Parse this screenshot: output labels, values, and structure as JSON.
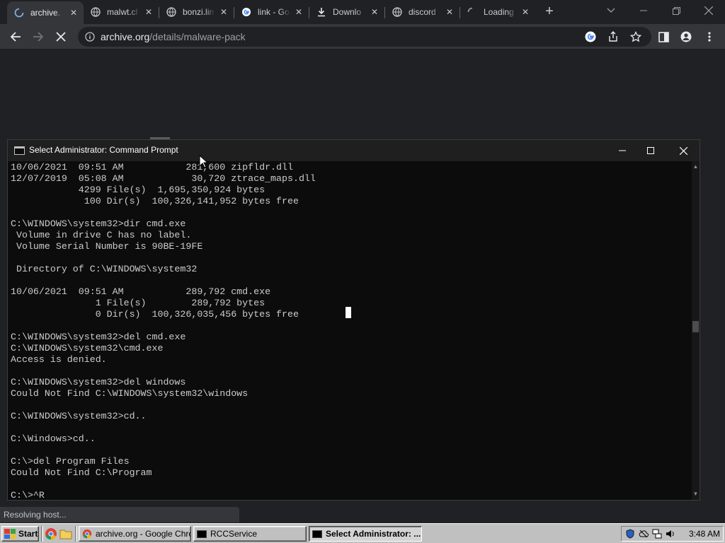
{
  "browser": {
    "tabs": [
      {
        "title": "archive.",
        "icon": "loading-spinner-icon",
        "active": true
      },
      {
        "title": "malwt.cl",
        "icon": "globe-icon",
        "active": false
      },
      {
        "title": "bonzi.lin",
        "icon": "globe-icon",
        "active": false
      },
      {
        "title": "link - Go",
        "icon": "google-icon",
        "active": false
      },
      {
        "title": "Downlo",
        "icon": "download-icon",
        "active": false
      },
      {
        "title": "discord",
        "icon": "globe-icon",
        "active": false
      },
      {
        "title": "Loading",
        "icon": "loading-spinner-icon",
        "active": false
      }
    ],
    "new_tab": "+",
    "url_host": "archive.org",
    "url_path": "/details/malware-pack",
    "status_text": "Resolving host..."
  },
  "console": {
    "title": "Select Administrator: Command Prompt",
    "lines": [
      "10/06/2021  09:51 AM           281,600 zipfldr.dll",
      "12/07/2019  05:08 AM            30,720 ztrace_maps.dll",
      "            4299 File(s)  1,695,350,924 bytes",
      "             100 Dir(s)  100,326,141,952 bytes free",
      "",
      "C:\\WINDOWS\\system32>dir cmd.exe",
      " Volume in drive C has no label.",
      " Volume Serial Number is 90BE-19FE",
      "",
      " Directory of C:\\WINDOWS\\system32",
      "",
      "10/06/2021  09:51 AM           289,792 cmd.exe",
      "               1 File(s)        289,792 bytes",
      "               0 Dir(s)  100,326,035,456 bytes free",
      "",
      "C:\\WINDOWS\\system32>del cmd.exe",
      "C:\\WINDOWS\\system32\\cmd.exe",
      "Access is denied.",
      "",
      "C:\\WINDOWS\\system32>del windows",
      "Could Not Find C:\\WINDOWS\\system32\\windows",
      "",
      "C:\\WINDOWS\\system32>cd..",
      "",
      "C:\\Windows>cd..",
      "",
      "C:\\>del Program Files",
      "Could Not Find C:\\Program",
      "",
      "C:\\>^R"
    ]
  },
  "taskbar": {
    "start_label": "Start",
    "buttons": [
      {
        "label": "archive.org - Google Chro...",
        "pressed": false
      },
      {
        "label": "RCCService",
        "pressed": false
      },
      {
        "label": "Select Administrator: ...",
        "pressed": true
      }
    ],
    "clock": "3:48 AM"
  }
}
